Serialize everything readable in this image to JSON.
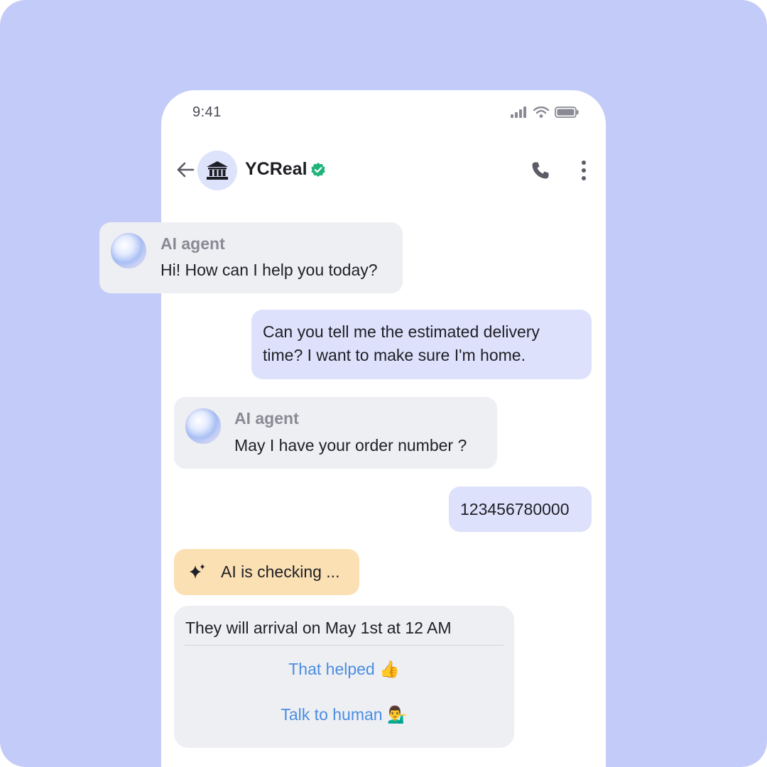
{
  "status_bar": {
    "time": "9:41"
  },
  "header": {
    "title": "YCReal"
  },
  "messages": {
    "agent1": {
      "sender": "AI agent",
      "text": "Hi! How can I help you today?"
    },
    "user1": {
      "line1": "Can you tell me the estimated delivery",
      "line2": "time? I want to make sure I'm home."
    },
    "agent2": {
      "sender": "AI agent",
      "text": "May I have your order number ?"
    },
    "user2": {
      "text": "123456780000"
    },
    "checking": {
      "text": "AI is checking ..."
    },
    "final": {
      "text": "They will arrival on May 1st at 12 AM",
      "action1": "That helped 👍",
      "action2": "Talk to human 💁‍♂️"
    }
  },
  "colors": {
    "background": "#c3ccf8",
    "agent_bubble": "#eeeff2",
    "user_bubble": "#dde1fb",
    "checking_bubble": "#fbe0b3",
    "link": "#4a8de4",
    "verified": "#1fb37a"
  },
  "icons": [
    "back-arrow-icon",
    "bank-icon",
    "verified-icon",
    "phone-icon",
    "more-vertical-icon",
    "signal-icon",
    "wifi-icon",
    "battery-icon",
    "sparkle-icon"
  ]
}
